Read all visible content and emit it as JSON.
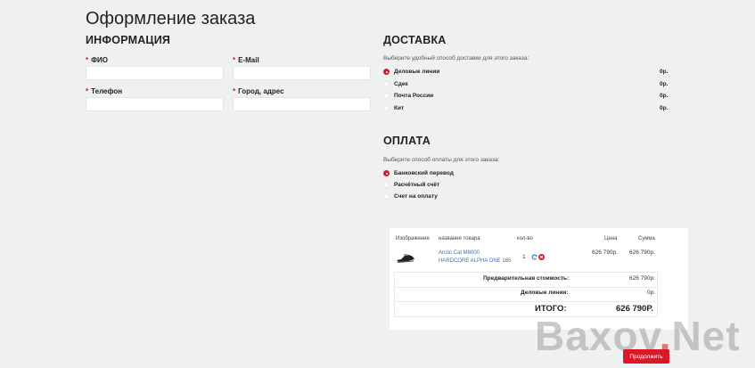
{
  "page": {
    "title": "Оформление заказа"
  },
  "info": {
    "heading": "ИНФОРМАЦИЯ",
    "fields": {
      "name": {
        "label": "ФИО",
        "value": ""
      },
      "email": {
        "label": "E-Mail",
        "value": ""
      },
      "phone": {
        "label": "Телефон",
        "value": ""
      },
      "address": {
        "label": "Город, адрес",
        "value": ""
      }
    },
    "required_mark": "*"
  },
  "delivery": {
    "heading": "ДОСТАВКА",
    "hint": "Выберите удобный способ доставки для этого заказа:",
    "options": [
      {
        "label": "Деловые линии",
        "price": "0р.",
        "selected": true
      },
      {
        "label": "Сдек",
        "price": "0р.",
        "selected": false
      },
      {
        "label": "Почта России",
        "price": "0р.",
        "selected": false
      },
      {
        "label": "Кит",
        "price": "0р.",
        "selected": false
      }
    ]
  },
  "payment": {
    "heading": "ОПЛАТА",
    "hint": "Выберите способ оплаты для этого заказа:",
    "options": [
      {
        "label": "Банковский перевод",
        "selected": true
      },
      {
        "label": "Расчётный счёт",
        "selected": false
      },
      {
        "label": "Счет на оплату",
        "selected": false
      }
    ]
  },
  "cart": {
    "headers": {
      "image": "Изображение",
      "name": "название товара",
      "qty": "кол-во",
      "price": "Цена",
      "sum": "Сумма"
    },
    "item": {
      "name_line1": "Arctic Cat M8000",
      "name_line2": "HARDCORE ALPHA ONE 165",
      "qty": "1",
      "price": "626 790р.",
      "sum": "626 790р."
    },
    "totals": {
      "subtotal_label": "Предварительная стоимость:",
      "subtotal_value": "626 790р.",
      "delivery_label": "Деловые линии:",
      "delivery_value": "0р.",
      "total_label": "ИТОГО:",
      "total_value": "626 790Р."
    }
  },
  "submit_label": "Продолжить",
  "watermark": {
    "part1": "Baxov",
    "dot": ".",
    "part2": "Net"
  },
  "colors": {
    "accent": "#d9182a",
    "link": "#3b6fb5",
    "background": "#eef1ef"
  }
}
